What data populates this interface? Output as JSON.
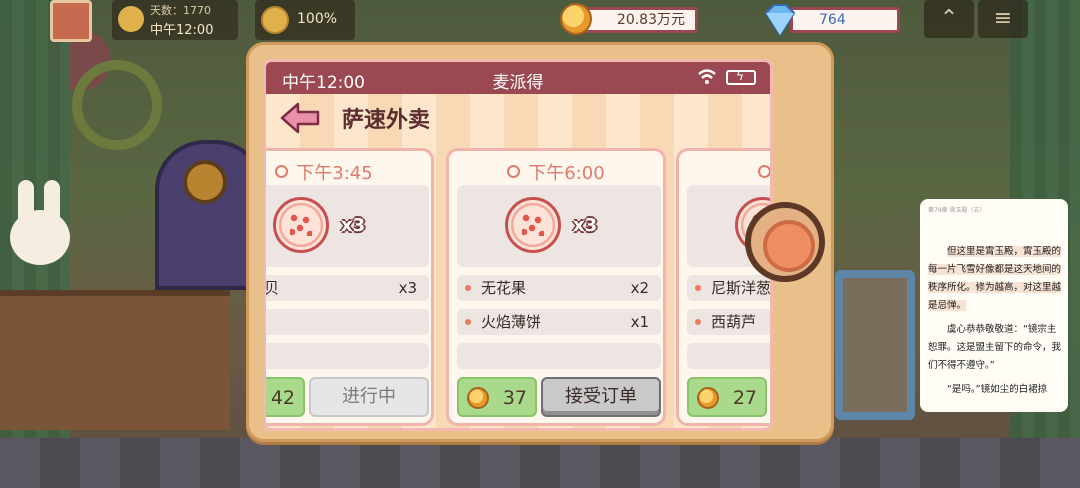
{
  "hud": {
    "days_label": "天数：1770",
    "time": "中午12:00",
    "mood": "100%",
    "coins": "20.83万元",
    "gems": "764",
    "up_glyph": "⌃",
    "menu_glyph": "≡"
  },
  "phone": {
    "status_time": "中午12:00",
    "status_title": "麦派得",
    "page_title": "萨速外卖",
    "icons": [
      "wifi-icon",
      "battery-icon",
      "back-arrow-icon"
    ],
    "colors": {
      "statusbar": "#9b4852",
      "accent": "#e07a6a"
    }
  },
  "orders": [
    {
      "time": "下午3:45",
      "dish_qty": "x3",
      "items": [
        {
          "name": "扇贝",
          "count": "x3"
        },
        {
          "name": "",
          "count": ""
        },
        {
          "name": "",
          "count": ""
        }
      ],
      "reward": "42",
      "action": "进行中"
    },
    {
      "time": "下午6:00",
      "dish_qty": "x3",
      "items": [
        {
          "name": "无花果",
          "count": "x2"
        },
        {
          "name": "火焰薄饼",
          "count": "x1"
        },
        {
          "name": "",
          "count": ""
        }
      ],
      "reward": "37",
      "action": "接受订单"
    },
    {
      "time": "下午",
      "dish_qty": "",
      "items": [
        {
          "name": "尼斯洋葱",
          "count": ""
        },
        {
          "name": "西葫芦",
          "count": ""
        },
        {
          "name": "",
          "count": ""
        }
      ],
      "reward": "27",
      "action": ""
    }
  ],
  "reader": {
    "header": "第79章 霄玉殿（五）",
    "paragraphs": [
      "但这里是霄玉殿，霄玉殿的每一片飞雪好像都是这天地间的秩序所化。修为越高，对这里越是忌惮。",
      "虞心恭恭敬敬道：“镜宗主恕罪。这是盟主留下的命令，我们不得不遵守。”",
      "“是吗。”镜如尘的白裙掠"
    ]
  }
}
